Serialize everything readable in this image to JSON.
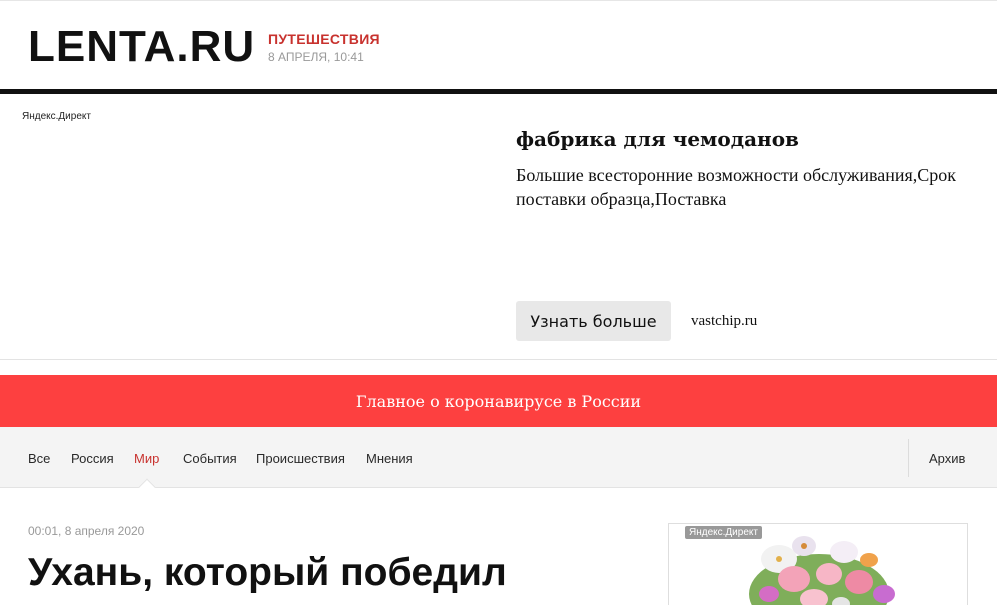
{
  "header": {
    "logo": "LENTA.RU",
    "section": "ПУТЕШЕСТВИЯ",
    "date": "8 АПРЕЛЯ, 10:41"
  },
  "ad": {
    "label": "Яндекс.Директ",
    "title": "фабрика для чемоданов",
    "text": "Большие всесторонние возможности обслуживания,Срок поставки образца,Поставка",
    "button_label": "Узнать больше",
    "domain": "vastchip.ru"
  },
  "banner": {
    "text": "Главное о коронавирусе в России"
  },
  "nav": {
    "items": [
      {
        "label": "Все"
      },
      {
        "label": "Россия"
      },
      {
        "label": "Мир"
      },
      {
        "label": "События"
      },
      {
        "label": "Происшествия"
      },
      {
        "label": "Мнения"
      }
    ],
    "active": "Мир",
    "archive": "Архив"
  },
  "article": {
    "meta": "00:01, 8 апреля 2020",
    "title": "Ухань, который победил"
  },
  "side_ad": {
    "label": "Яндекс.Директ"
  },
  "colors": {
    "accent": "#c8322e",
    "banner": "#fd4040",
    "nav_bg": "#f4f4f4"
  }
}
